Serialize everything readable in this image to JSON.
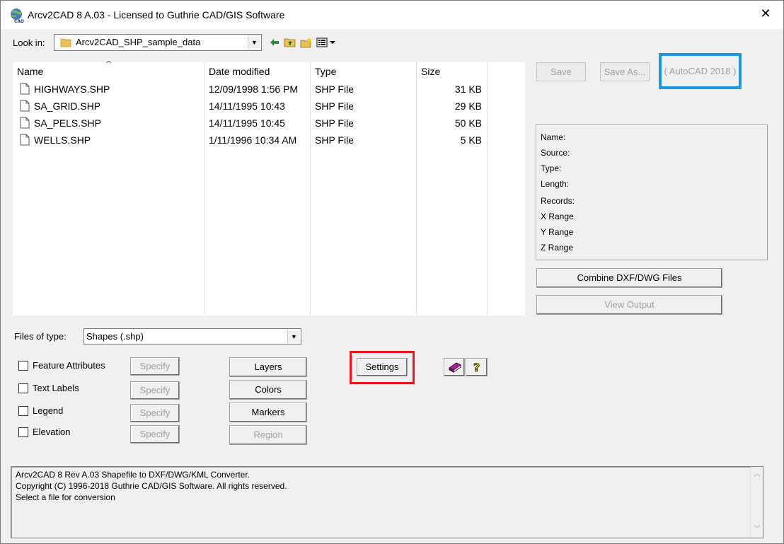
{
  "window": {
    "title": "Arcv2CAD 8 A.03 - Licensed to Guthrie CAD/GIS Software"
  },
  "lookin": {
    "label": "Look in:",
    "folder": "Arcv2CAD_SHP_sample_data"
  },
  "filelist": {
    "columns": [
      "Name",
      "Date modified",
      "Type",
      "Size"
    ],
    "rows": [
      {
        "name": "HIGHWAYS.SHP",
        "date": "12/09/1998 1:56 PM",
        "type": "SHP File",
        "size": "31 KB"
      },
      {
        "name": "SA_GRID.SHP",
        "date": "14/11/1995 10:43",
        "type": "SHP File",
        "size": "29 KB"
      },
      {
        "name": "SA_PELS.SHP",
        "date": "14/11/1995 10:45",
        "type": "SHP File",
        "size": "50 KB"
      },
      {
        "name": "WELLS.SHP",
        "date": "1/11/1996 10:34 AM",
        "type": "SHP File",
        "size": "5 KB"
      }
    ]
  },
  "filetype": {
    "label": "Files of type:",
    "value": "Shapes (.shp)"
  },
  "buttons": {
    "save": "Save",
    "save_as": "Save As...",
    "autocad": "( AutoCAD 2018 )",
    "combine": "Combine DXF/DWG Files",
    "view_output": "View Output",
    "layers": "Layers",
    "colors": "Colors",
    "markers": "Markers",
    "region": "Region",
    "settings": "Settings",
    "specify": "Specify"
  },
  "info": {
    "labels": [
      "Name:",
      "Source:",
      "Type:",
      "Length:",
      "Records:",
      "X Range",
      "Y Range",
      "Z Range"
    ]
  },
  "options": {
    "feature_attributes": "Feature Attributes",
    "text_labels": "Text Labels",
    "legend": "Legend",
    "elevation": "Elevation"
  },
  "status": {
    "lines": [
      "Arcv2CAD 8 Rev A.03 Shapefile to DXF/DWG/KML Converter.",
      "Copyright (C) 1996-2018 Guthrie CAD/GIS Software.  All rights reserved.",
      "Select a file for conversion"
    ]
  },
  "colors": {
    "highlight_red": "#e8171f",
    "highlight_blue": "#1a9ae0",
    "window_bg": "#f0f0f0"
  }
}
